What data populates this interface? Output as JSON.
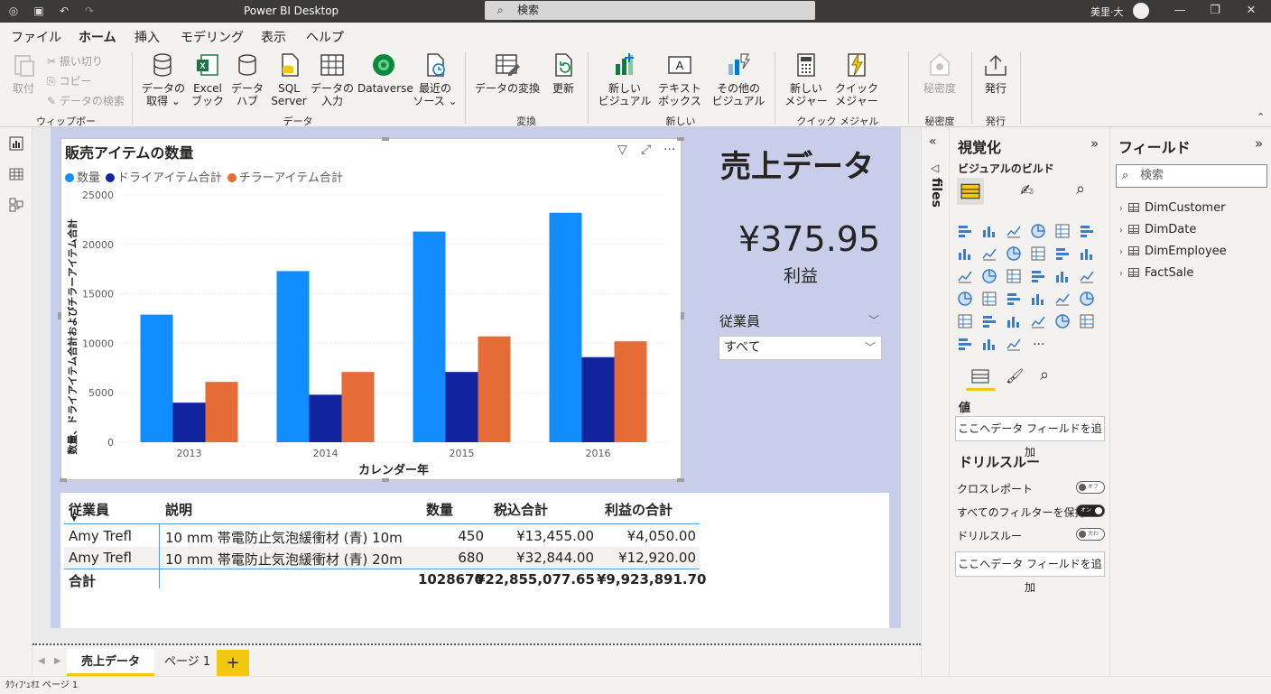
{
  "window": {
    "title": "Power BI Desktop",
    "search_text": "検索",
    "user": "美里·大"
  },
  "ribbon_tabs": [
    "ファイル",
    "ホーム",
    "挿入",
    "モデリング",
    "表示",
    "ヘルプ"
  ],
  "ribbon": {
    "clipboard": {
      "paste": "取付",
      "cut": "振い切り",
      "copy": "コピー",
      "format_painter": "データの検索",
      "label": "ウィップボード"
    },
    "data": {
      "get_data": [
        "データの",
        "取得 ⌄"
      ],
      "excel": [
        "Excel",
        "ブック"
      ],
      "datahub": [
        "データ",
        "ハブ"
      ],
      "sql": [
        "SQL",
        "Server"
      ],
      "enter_data": [
        "データの",
        "入力"
      ],
      "dataverse": "Dataverse",
      "recent": [
        "最近の",
        "ソース ⌄"
      ],
      "label": "データ"
    },
    "queries": {
      "transform": "データの変換",
      "refresh": "更新",
      "label": "変換"
    },
    "insert": {
      "new_visual": [
        "新しい",
        "ビジュアル"
      ],
      "textbox": [
        "テキスト",
        "ボックス"
      ],
      "more_visuals": [
        "その他の",
        "ビジュアル"
      ],
      "label": "新しい"
    },
    "calc": {
      "new_measure": [
        "新しい",
        "メジャー"
      ],
      "quick_measure": [
        "クイック",
        "メジャー"
      ],
      "label": "クイック メジャル"
    },
    "sensitivity": {
      "btn": "秘密度",
      "label": "秘密度"
    },
    "share": {
      "publish": "発行",
      "label": "発行"
    }
  },
  "chart_data": {
    "type": "bar",
    "title": "販売アイテムの数量",
    "xlabel": "カレンダー年",
    "ylabel": "数量、ドライアイテム合計およびチラーアイテム合計",
    "categories": [
      "2013",
      "2014",
      "2015",
      "2016"
    ],
    "ylim": [
      0,
      25000
    ],
    "yticks": [
      0,
      5000,
      10000,
      15000,
      20000,
      25000
    ],
    "legend_position": "top-left",
    "grid": true,
    "series": [
      {
        "name": "数量",
        "color": "#118dff",
        "values": [
          12900,
          17300,
          21300,
          23200
        ]
      },
      {
        "name": "ドライアイテム合計",
        "color": "#12239e",
        "values": [
          4000,
          4800,
          7100,
          8600
        ]
      },
      {
        "name": "チラーアイテム合計",
        "color": "#e66c37",
        "values": [
          6100,
          7100,
          10700,
          10200
        ]
      }
    ]
  },
  "kpi": {
    "title": "売上データ",
    "value": "¥375.95",
    "label": "利益"
  },
  "slicer": {
    "title": "従業員",
    "selected": "すべて"
  },
  "table": {
    "headers": [
      "従業員",
      "説明",
      "数量",
      "税込合計",
      "利益の合計"
    ],
    "rows": [
      [
        "Amy Trefl",
        "10 mm 帯電防止気泡緩衝材 (青) 10m",
        "450",
        "¥13,455.00",
        "¥4,050.00"
      ],
      [
        "Amy Trefl",
        "10 mm 帯電防止気泡緩衝材 (青) 20m",
        "680",
        "¥32,844.00",
        "¥12,920.00"
      ]
    ],
    "total": [
      "合計",
      "",
      "1028670",
      "¥22,855,077.65",
      "¥9,923,891.70"
    ]
  },
  "page_tabs": [
    "売上データ",
    "ページ 1"
  ],
  "add_page": "+",
  "status": "ﾀｳｨﾌ'ｭｵｴ  ページ 1",
  "filters_pane": {
    "label": "files"
  },
  "viz_pane": {
    "title": "視覚化",
    "build_label": "ビジュアルのビルド",
    "values_label": "値",
    "add_field": "ここへデータ フィールドを追加",
    "drill_title": "ドリルスルー",
    "cross_report": "クロスレポート",
    "keep_filters": "すべてのフィルターを保持",
    "drill_label": "ドリルスルー",
    "add_drill_field": "ここへデータ フィールドを追加",
    "toggle_off": "オフ",
    "toggle_on": "オン",
    "toggle_off2": "大わ",
    "more": "···"
  },
  "fields_pane": {
    "title": "フィールド",
    "search": "検索",
    "tables": [
      "DimCustomer",
      "DimDate",
      "DimEmployee",
      "FactSale"
    ]
  }
}
